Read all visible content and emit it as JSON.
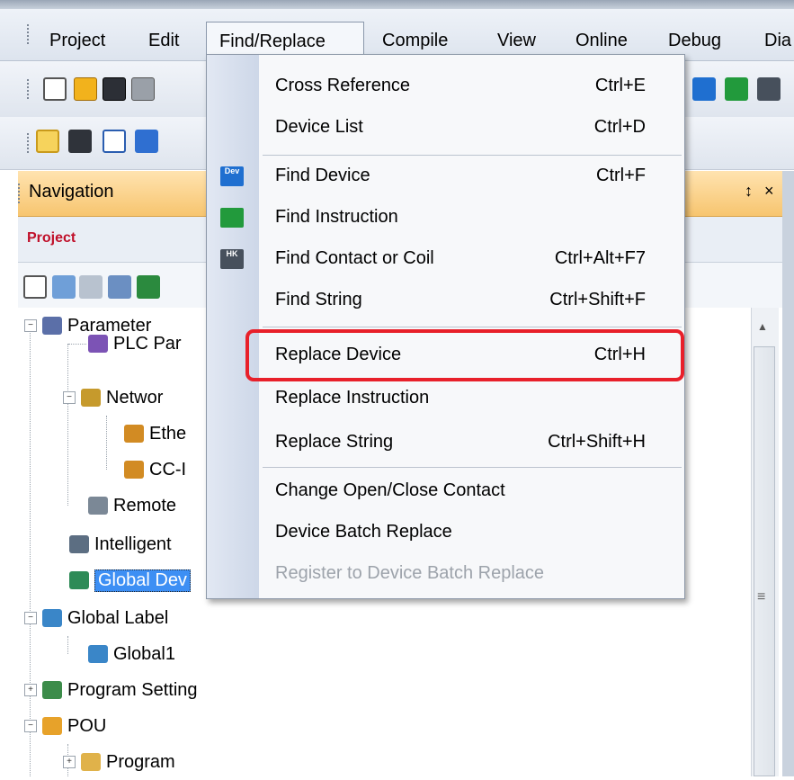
{
  "menubar": {
    "items": [
      "Project",
      "Edit",
      "Find/Replace",
      "Compile",
      "View",
      "Online",
      "Debug",
      "Dia"
    ],
    "active": "Find/Replace"
  },
  "navigation": {
    "title": "Navigation",
    "pin_glyph": "↕",
    "close_glyph": "×",
    "project_label": "Project"
  },
  "tree": {
    "items": [
      {
        "label": "Parameter",
        "toggle": "−"
      },
      {
        "label": "PLC Par",
        "toggle": ""
      },
      {
        "label": "Networ",
        "toggle": "−"
      },
      {
        "label": "Ethe",
        "toggle": ""
      },
      {
        "label": "CC-I",
        "toggle": ""
      },
      {
        "label": "Remote",
        "toggle": ""
      },
      {
        "label": "Intelligent",
        "toggle": ""
      },
      {
        "label": "Global Dev",
        "toggle": ""
      },
      {
        "label": "Global Label",
        "toggle": "−"
      },
      {
        "label": "Global1",
        "toggle": ""
      },
      {
        "label": "Program Setting",
        "toggle": "+"
      },
      {
        "label": "POU",
        "toggle": "−"
      },
      {
        "label": "Program",
        "toggle": "+"
      }
    ]
  },
  "dropdown": {
    "items": [
      {
        "label": "Cross Reference",
        "shortcut": "Ctrl+E"
      },
      {
        "label": "Device List",
        "shortcut": "Ctrl+D"
      },
      {
        "label": "Find Device",
        "shortcut": "Ctrl+F",
        "icon": "Dev"
      },
      {
        "label": "Find Instruction",
        "shortcut": "",
        "icon": ""
      },
      {
        "label": "Find Contact or Coil",
        "shortcut": "Ctrl+Alt+F7",
        "icon": "HK"
      },
      {
        "label": "Find String",
        "shortcut": "Ctrl+Shift+F"
      },
      {
        "label": "Replace Device",
        "shortcut": "Ctrl+H"
      },
      {
        "label": "Replace Instruction",
        "shortcut": ""
      },
      {
        "label": "Replace String",
        "shortcut": "Ctrl+Shift+H"
      },
      {
        "label": "Change Open/Close Contact",
        "shortcut": ""
      },
      {
        "label": "Device Batch Replace",
        "shortcut": ""
      },
      {
        "label": "Register to Device Batch Replace",
        "shortcut": "",
        "disabled": true
      }
    ]
  },
  "scrollbar": {
    "up_glyph": "▲",
    "grip_glyph": "≡"
  },
  "colors": {
    "highlight": "#e8202a",
    "selection": "#3d8ff4",
    "nav_header": "#f7c56f",
    "project_label": "#c0102a"
  }
}
